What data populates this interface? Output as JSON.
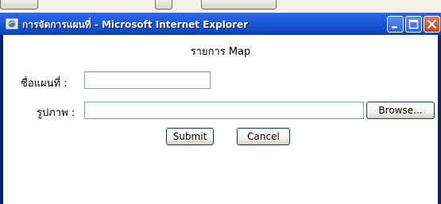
{
  "window": {
    "title": "การจัดการแผนที่ - Microsoft Internet Explorer",
    "icon": "ie-icon"
  },
  "controls": {
    "minimize": "minimize-icon",
    "maximize": "maximize-icon",
    "close": "close-icon"
  },
  "form": {
    "heading": "รายการ Map",
    "map_name_label": "ชื่อแผนที่ :",
    "map_name_value": "",
    "image_label": "รูปภาพ :",
    "image_value": "",
    "browse_label": "Browse...",
    "submit_label": "Submit",
    "cancel_label": "Cancel"
  },
  "colors": {
    "titlebar": "#1f5ad8",
    "close_button": "#c1411f",
    "input_border": "#7f9db9",
    "button_border": "#003c74"
  }
}
